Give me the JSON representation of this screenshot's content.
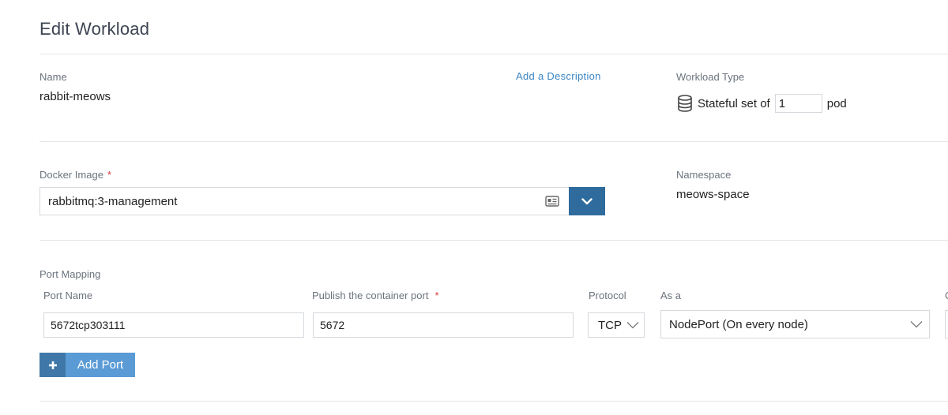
{
  "page": {
    "title": "Edit Workload"
  },
  "name_section": {
    "label": "Name",
    "value": "rabbit-meows",
    "add_description_label": "Add a Description"
  },
  "workload_type": {
    "label": "Workload Type",
    "prefix": "Stateful set of",
    "scale": "1",
    "suffix": "pod",
    "icon": "database-icon"
  },
  "docker_image": {
    "label": "Docker Image",
    "required_mark": "*",
    "value": "rabbitmq:3-management",
    "icon": "id-card-icon",
    "dropdown_icon": "chevron-down-icon"
  },
  "namespace": {
    "label": "Namespace",
    "value": "meows-space"
  },
  "port_mapping": {
    "label": "Port Mapping",
    "columns": {
      "port_name": "Port Name",
      "publish_port": "Publish the container port",
      "publish_required": "*",
      "protocol": "Protocol",
      "as_a": "As a",
      "cut_off": "C"
    },
    "row": {
      "port_name": "5672tcp303111",
      "publish_port": "5672",
      "protocol": "TCP",
      "as_a": "NodePort (On every node)"
    },
    "add_port_label": "Add Port",
    "add_port_icon": "plus-icon"
  },
  "colors": {
    "accent": "#2f6b9c",
    "button": "#5a9bd5",
    "link": "#3a86c4",
    "required": "#d43c3c"
  }
}
